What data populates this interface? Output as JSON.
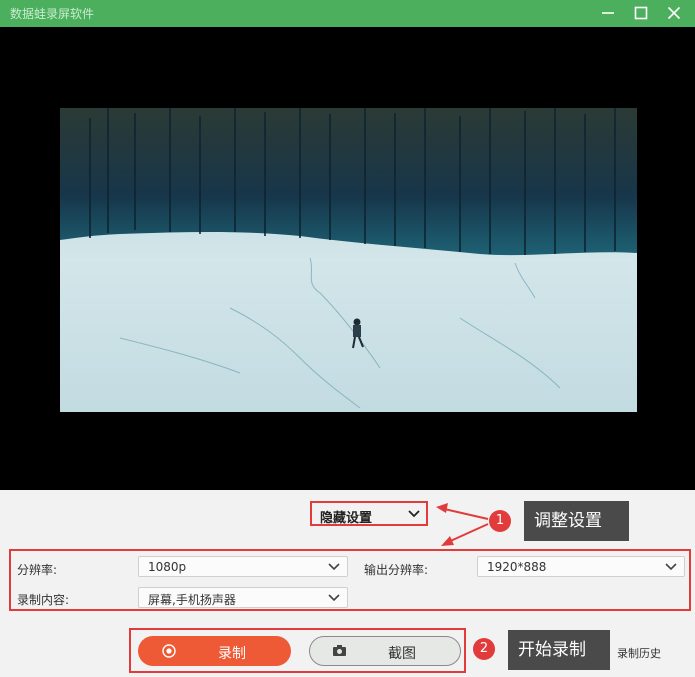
{
  "window": {
    "title": "数据蛙录屏软件",
    "controls": [
      "minimize-icon",
      "maximize-icon",
      "close-icon"
    ],
    "titlebar_color": "#4caf5e"
  },
  "preview": {
    "description_icon": "snow-field-video-frame"
  },
  "settings_toggle": {
    "label": "隐藏设置"
  },
  "callouts": [
    {
      "number": "1",
      "text": "调整设置"
    },
    {
      "number": "2",
      "text": "开始录制"
    }
  ],
  "settings": {
    "resolution_label": "分辨率:",
    "resolution_value": "1080p",
    "output_resolution_label": "输出分辨率:",
    "output_resolution_value": "1920*888",
    "content_label": "录制内容:",
    "content_value": "屏幕,手机扬声器"
  },
  "actions": {
    "record_label": "录制",
    "screenshot_label": "截图",
    "history_label": "录制历史"
  },
  "colors": {
    "accent_red": "#e23b3b",
    "record_orange": "#ee5a35",
    "callout_bg": "#4a4a4a"
  }
}
